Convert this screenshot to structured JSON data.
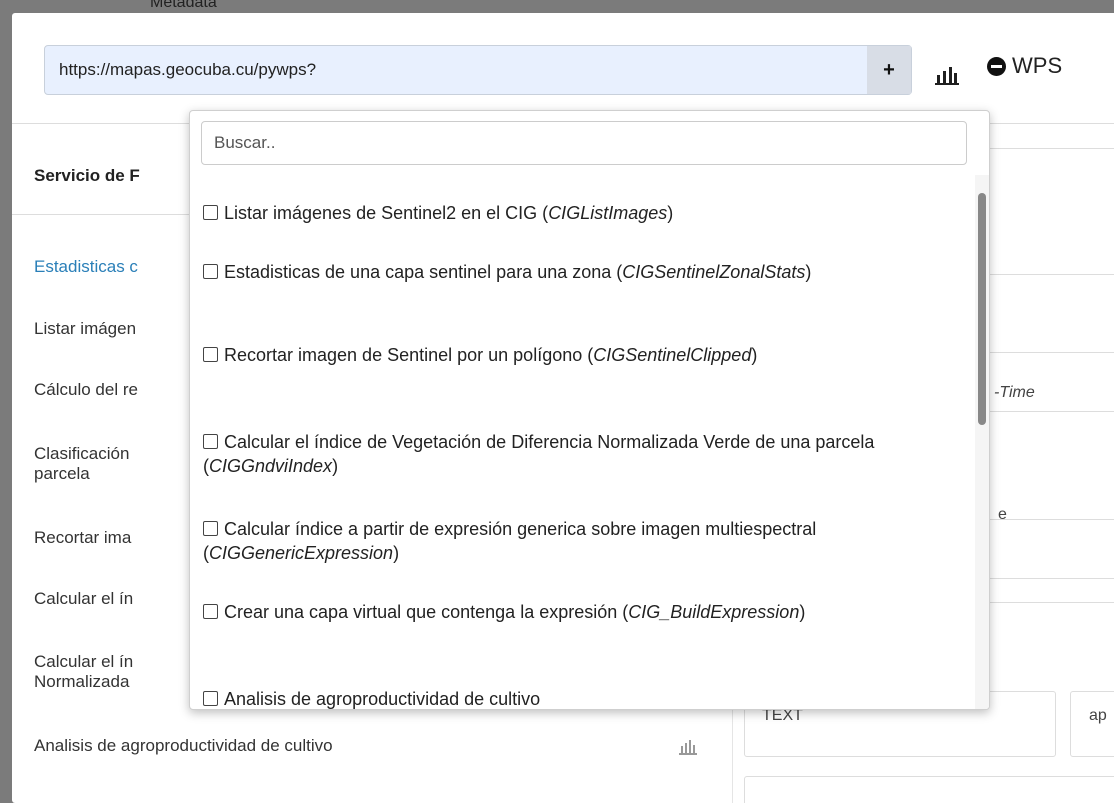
{
  "background": {
    "text": "Metadata"
  },
  "url_bar": {
    "value": "https://mapas.geocuba.cu/pywps?",
    "add_label": "+"
  },
  "header": {
    "chart_icon": "bar-chart-icon",
    "wps_icon": "minus-circle-icon",
    "wps_label": "WPS"
  },
  "left": {
    "title": "Servicio de F",
    "processes": [
      "Estadisticas c",
      "Listar imágen",
      "Cálculo del re",
      "Clasificación\nparcela",
      "Recortar ima",
      "Calcular el ín",
      "Calcular el ín\nNormalizada",
      "Analisis de agroproductividad de cultivo"
    ]
  },
  "right": {
    "time_label": "-Time",
    "fragment_e": "e",
    "text_value": "TEXT",
    "fragment_ap": "ap"
  },
  "dropdown": {
    "search_placeholder": "Buscar..",
    "items": [
      {
        "label": "Listar imágenes de Sentinel2 en el CIG (",
        "id": "CIGListImages",
        "close": ")"
      },
      {
        "label": "Estadisticas de una capa sentinel para una zona (",
        "id": "CIGSentinelZonalStats",
        "close": ")"
      },
      {
        "label": "Recortar imagen de Sentinel por un polígono (",
        "id": "CIGSentinelClipped",
        "close": ")"
      },
      {
        "label": "Calcular el índice de Vegetación de Diferencia Normalizada Verde de una parcela (",
        "id": "CIGGndviIndex",
        "close": ")"
      },
      {
        "label": "Calcular índice a partir de expresión generica sobre imagen multiespectral (",
        "id": "CIGGenericExpression",
        "close": ")"
      },
      {
        "label": "Crear una capa virtual que contenga la expresión (",
        "id": "CIG_BuildExpression",
        "close": ")"
      },
      {
        "label": "Analisis de agroproductividad de cultivo",
        "id": "",
        "close": ""
      }
    ]
  }
}
